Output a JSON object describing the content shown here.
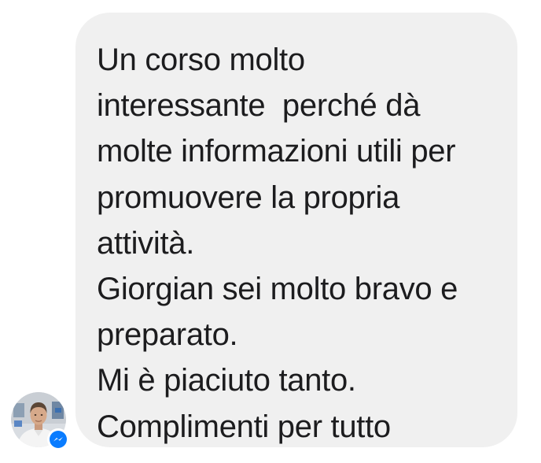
{
  "message": {
    "lines": [
      "Un corso molto",
      "interessante  perché dà",
      "molte informazioni utili per",
      "promuovere la propria",
      "attività.",
      "Giorgian sei molto bravo e",
      "preparato.",
      "Mi è piaciuto tanto.",
      "Complimenti per tutto"
    ]
  },
  "sender": {
    "avatar_icon": "person-avatar",
    "badge_icon": "messenger-icon",
    "badge_color": "#0a7cff"
  },
  "colors": {
    "bubble_background": "#f0f0f0",
    "text": "#1c1c1e",
    "page_background": "#ffffff"
  }
}
